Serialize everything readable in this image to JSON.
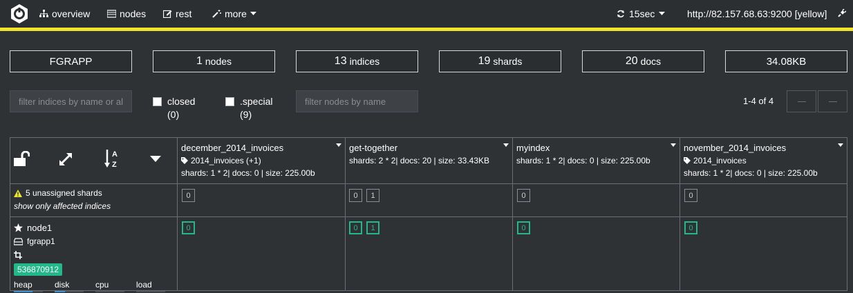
{
  "nav": {
    "items": [
      {
        "label": "overview",
        "icon": "sitemap-icon"
      },
      {
        "label": "nodes",
        "icon": "server-icon"
      },
      {
        "label": "rest",
        "icon": "edit-icon"
      },
      {
        "label": "more",
        "icon": "magic-icon"
      }
    ],
    "refresh_label": "15sec",
    "cluster_url": "http://82.157.68.63:9200 [yellow]"
  },
  "stats": {
    "cluster_name": "FGRAPP",
    "nodes_count": "1",
    "nodes_unit": "nodes",
    "indices_count": "13",
    "indices_unit": "indices",
    "shards_count": "19",
    "shards_unit": "shards",
    "docs_count": "20",
    "docs_unit": "docs",
    "size": "34.08KB"
  },
  "filters": {
    "indices_placeholder": "filter indices by name or al",
    "closed_label": "closed",
    "closed_count": "(0)",
    "special_label": ".special",
    "special_count": "(9)",
    "nodes_placeholder": "filter nodes by name",
    "pager": "1-4 of 4"
  },
  "indices": [
    {
      "name": "december_2014_invoices",
      "alias": "2014_invoices (+1)",
      "stats": "shards: 1 * 2| docs: 0 | size: 225.00b",
      "unassigned": [
        "0"
      ],
      "assigned": [
        "0"
      ]
    },
    {
      "name": "get-together",
      "alias": "",
      "stats": "shards: 2 * 2| docs: 20 | size: 33.43KB",
      "unassigned": [
        "0",
        "1"
      ],
      "assigned": [
        "0",
        "1"
      ]
    },
    {
      "name": "myindex",
      "alias": "",
      "stats": "shards: 1 * 2| docs: 0 | size: 225.00b",
      "unassigned": [
        "0"
      ],
      "assigned": [
        "0"
      ]
    },
    {
      "name": "november_2014_invoices",
      "alias": "2014_invoices",
      "stats": "shards: 1 * 2| docs: 0 | size: 225.00b",
      "unassigned": [
        "0"
      ],
      "assigned": [
        "0"
      ]
    }
  ],
  "unassigned": {
    "label": "5 unassigned shards",
    "link": "show only affected indices"
  },
  "node": {
    "name": "node1",
    "host": "fgrapp1",
    "id": "536870912",
    "meters": [
      {
        "label": "heap",
        "fill": 0.65
      },
      {
        "label": "disk",
        "fill": 0.35
      },
      {
        "label": "cpu",
        "fill": 0.0
      },
      {
        "label": "load",
        "fill": 0.0
      }
    ]
  },
  "colors": {
    "accent_yellow": "#f0e52c",
    "shard_green": "#23b887",
    "background": "#2f3235"
  }
}
